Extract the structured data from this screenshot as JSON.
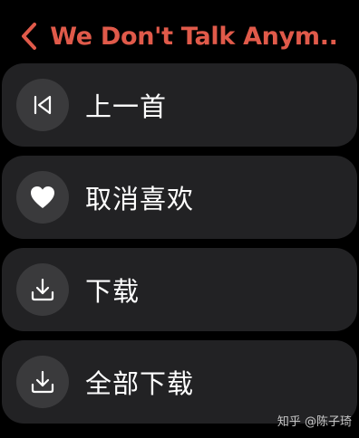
{
  "header": {
    "back_icon": "chevron-left-icon",
    "title": "We Don't Talk Anym..."
  },
  "menu": {
    "items": [
      {
        "icon": "previous-track-icon",
        "label": "上一首"
      },
      {
        "icon": "heart-icon",
        "label": "取消喜欢"
      },
      {
        "icon": "download-icon",
        "label": "下载"
      },
      {
        "icon": "download-icon",
        "label": "全部下载"
      }
    ]
  },
  "watermark": "知乎 @陈子琦",
  "colors": {
    "accent": "#e05a4a",
    "background": "#000000",
    "card": "#222224",
    "icon_circle": "#3a3a3c"
  }
}
